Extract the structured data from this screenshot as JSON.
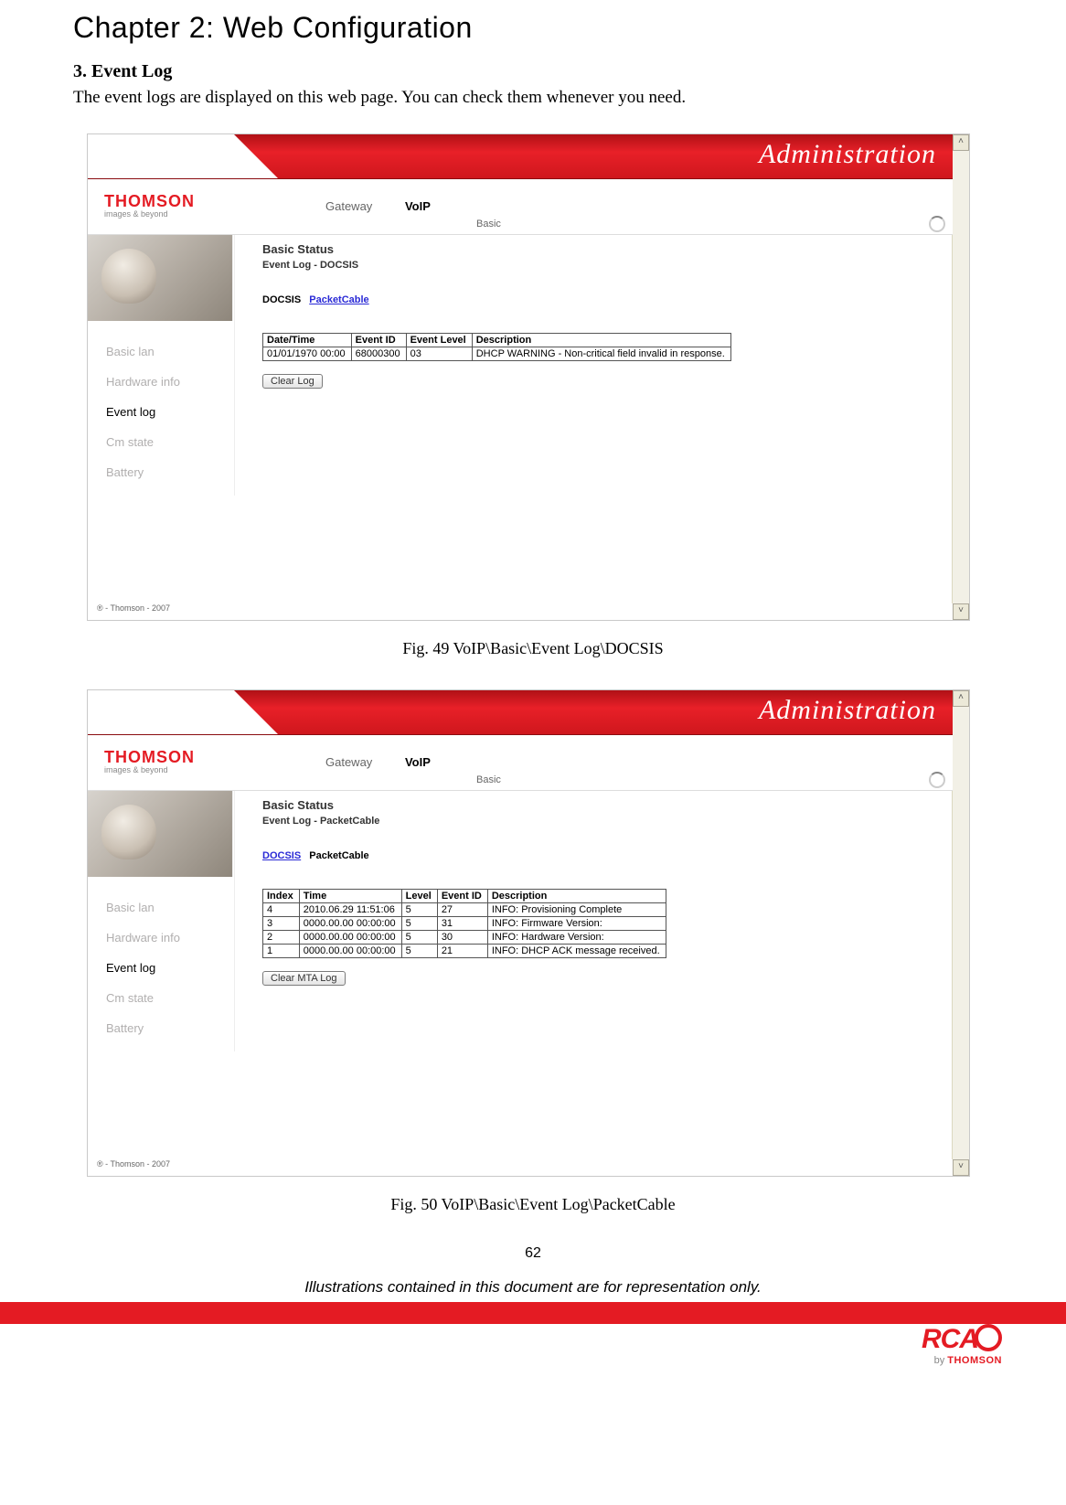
{
  "chapter_title": "Chapter 2: Web Configuration",
  "section_title": "3. Event Log",
  "section_body": "The event logs are displayed on this web page. You can check them whenever you need.",
  "admin_label": "Administration",
  "logo_main": "THOMSON",
  "logo_sub": "images & beyond",
  "nav": {
    "gateway": "Gateway",
    "voip": "VoIP",
    "basic": "Basic"
  },
  "sidenav": {
    "basic_lan": "Basic lan",
    "hardware_info": "Hardware info",
    "event_log": "Event log",
    "cm_state": "Cm state",
    "battery": "Battery"
  },
  "copyright": "® - Thomson - 2007",
  "fig49": {
    "title": "Basic Status",
    "subtitle": "Event Log - DOCSIS",
    "tab_docsis": "DOCSIS",
    "tab_packetcable": "PacketCable",
    "headers": {
      "dt": "Date/Time",
      "eid": "Event ID",
      "elv": "Event Level",
      "desc": "Description"
    },
    "rows": [
      {
        "dt": "01/01/1970 00:00",
        "eid": "68000300",
        "elv": "03",
        "desc": "DHCP WARNING - Non-critical field invalid in response."
      }
    ],
    "clear_btn": "Clear Log",
    "caption": "Fig. 49 VoIP\\Basic\\Event Log\\DOCSIS"
  },
  "fig50": {
    "title": "Basic Status",
    "subtitle": "Event Log - PacketCable",
    "tab_docsis": "DOCSIS",
    "tab_packetcable": "PacketCable",
    "headers": {
      "idx": "Index",
      "time": "Time",
      "lvl": "Level",
      "eid": "Event ID",
      "desc": "Description"
    },
    "rows": [
      {
        "idx": "4",
        "time": "2010.06.29 11:51:06",
        "lvl": "5",
        "eid": "27",
        "desc": "INFO: Provisioning Complete"
      },
      {
        "idx": "3",
        "time": "0000.00.00 00:00:00",
        "lvl": "5",
        "eid": "31",
        "desc": "INFO: Firmware Version:"
      },
      {
        "idx": "2",
        "time": "0000.00.00 00:00:00",
        "lvl": "5",
        "eid": "30",
        "desc": "INFO: Hardware Version:"
      },
      {
        "idx": "1",
        "time": "0000.00.00 00:00:00",
        "lvl": "5",
        "eid": "21",
        "desc": "INFO: DHCP ACK message received."
      }
    ],
    "clear_btn": "Clear MTA Log",
    "caption": "Fig. 50 VoIP\\Basic\\Event Log\\PacketCable"
  },
  "page_number": "62",
  "footer_note": "Illustrations contained in this document are for representation only.",
  "brand": {
    "rca": "RCA",
    "by": "by ",
    "thomson": "THOMSON"
  }
}
